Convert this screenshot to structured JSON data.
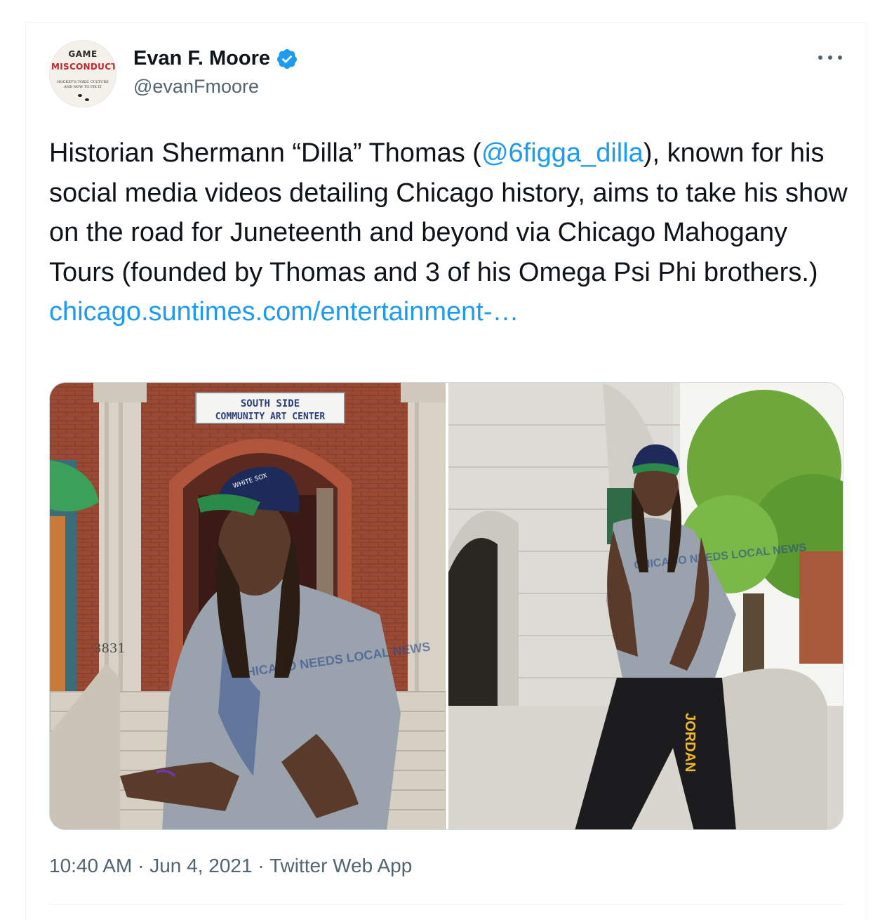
{
  "author": {
    "display_name": "Evan F. Moore",
    "handle": "@evanFmoore",
    "verified_icon": "verified-badge-icon",
    "avatar": {
      "line1": "GAME",
      "line2": "MISCONDUCT",
      "line3": "HOCKEY'S TOXIC CULTURE",
      "line4": "AND HOW TO FIX IT"
    }
  },
  "more_icon": "more-options-icon",
  "tweet": {
    "text_before": "Historian Shermann “Dilla” Thomas (",
    "mention": "@6figga_dilla",
    "text_after": "), known for his social media videos detailing Chicago history, aims to take his show on the road for Juneteenth and beyond via Chicago Mahogany Tours (founded by Thomas and 3 of his Omega Psi Phi brothers.)",
    "link": "chicago.suntimes.com/entertainment-…"
  },
  "media": {
    "left_photo": {
      "sign_line1": "SOUTH SIDE",
      "sign_line2": "COMMUNITY ART CENTER",
      "address": "3831",
      "shirt": "CHICAGO NEEDS LOCAL NEWS"
    },
    "right_photo": {
      "shirt": "CHICAGO NEEDS LOCAL NEWS",
      "pants": "JORDAN"
    }
  },
  "meta": {
    "time": "10:40 AM",
    "sep1": " · ",
    "date": "Jun 4, 2021",
    "sep2": " · ",
    "source": "Twitter Web App"
  },
  "colors": {
    "accent": "#1d9bf0",
    "text": "#0f1419",
    "secondary": "#536471",
    "border": "#cfd9de"
  }
}
